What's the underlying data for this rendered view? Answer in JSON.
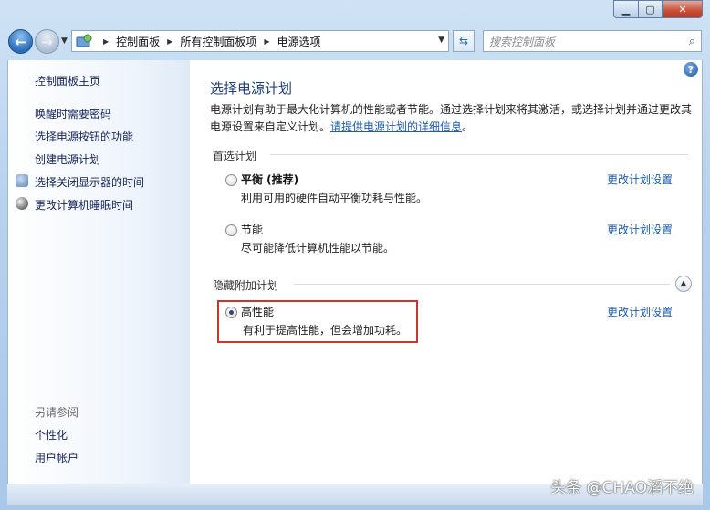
{
  "window": {
    "controls": {
      "minimize": "▁",
      "maximize": "▢",
      "close": "✕"
    }
  },
  "nav": {
    "back_icon": "back-arrow-icon",
    "forward_icon": "forward-arrow-icon",
    "breadcrumb": [
      "控制面板",
      "所有控制面板项",
      "电源选项"
    ],
    "search_placeholder": "搜索控制面板"
  },
  "sidebar": {
    "home_link": "控制面板主页",
    "links": [
      "唤醒时需要密码",
      "选择电源按钮的功能",
      "创建电源计划",
      "选择关闭显示器的时间",
      "更改计算机睡眠时间"
    ],
    "see_also": {
      "heading": "另请参阅",
      "links": [
        "个性化",
        "用户帐户"
      ]
    }
  },
  "main": {
    "title": "选择电源计划",
    "intro_text": "电源计划有助于最大化计算机的性能或者节能。通过选择计划来将其激活，或选择计划并通过更改其电源设置来自定义计划。",
    "intro_link": "请提供电源计划的详细信息",
    "intro_end": "。",
    "preferred": {
      "heading": "首选计划",
      "plans": [
        {
          "name": "平衡 (推荐)",
          "desc": "利用可用的硬件自动平衡功耗与性能。",
          "link": "更改计划设置",
          "checked": false
        },
        {
          "name": "节能",
          "desc": "尽可能降低计算机性能以节能。",
          "link": "更改计划设置",
          "checked": false
        }
      ]
    },
    "hidden": {
      "heading": "隐藏附加计划",
      "plans": [
        {
          "name": "高性能",
          "desc": "有利于提高性能，但会增加功耗。",
          "link": "更改计划设置",
          "checked": true
        }
      ]
    }
  },
  "watermark": "头条 @CHAO滔不绝",
  "colors": {
    "link": "#1a5bb5",
    "title": "#1e3f80",
    "highlight": "#c9362f"
  }
}
